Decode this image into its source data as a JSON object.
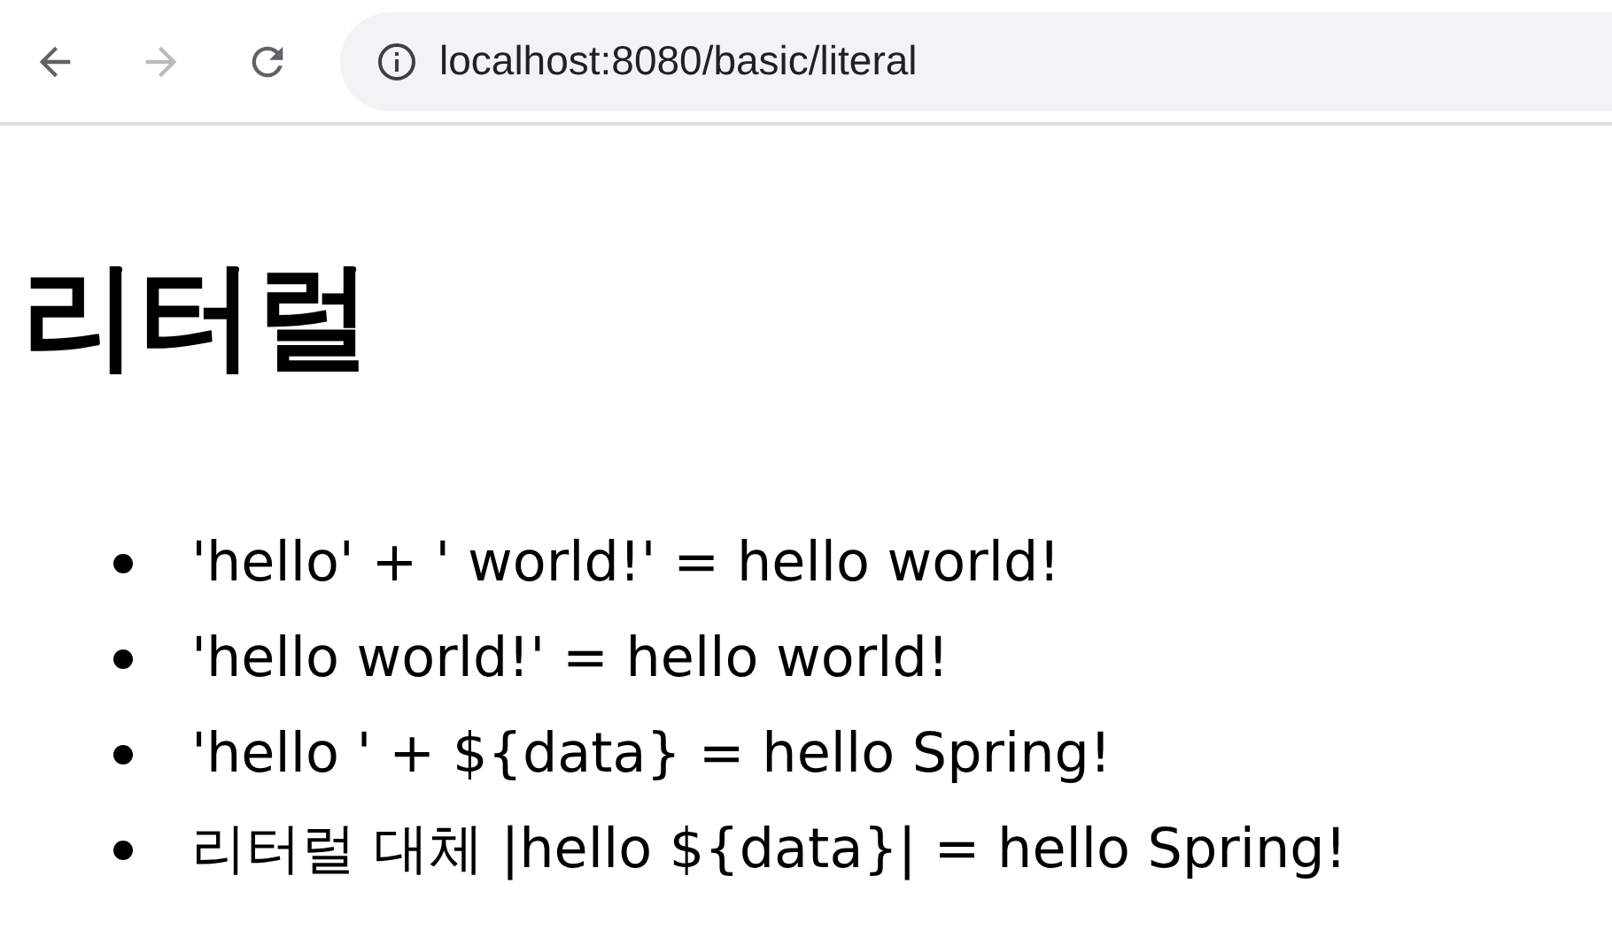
{
  "toolbar": {
    "buttons": [
      {
        "kind": "back",
        "disabled": false
      },
      {
        "kind": "forward",
        "disabled": true
      },
      {
        "kind": "reload",
        "disabled": false
      }
    ],
    "address": "localhost:8080/basic/literal"
  },
  "heading": "리터럴",
  "items": [
    "'hello' + ' world!' = hello world!",
    "'hello world!' = hello world!",
    "'hello ' + ${data} = hello Spring!",
    "리터럴 대체 |hello ${data}| = hello Spring!"
  ]
}
